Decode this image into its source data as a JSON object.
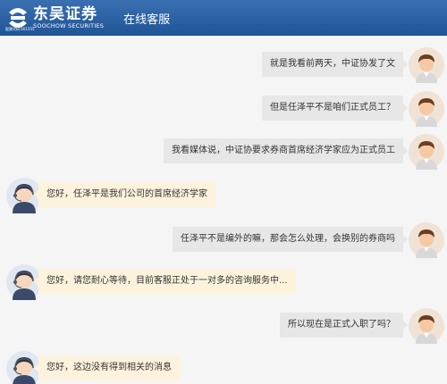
{
  "header": {
    "brand_cn": "东吴证券",
    "brand_en": "SOOCHOW SECURITIES",
    "brand_tag": "股票代码 601555",
    "title": "在线客服",
    "brand_color": "#1f5597"
  },
  "chat": {
    "messages": [
      {
        "sender": "user",
        "text": "就是我看前两天，中证协发了文"
      },
      {
        "sender": "user",
        "text": "但是任泽平不是咱们正式员工？"
      },
      {
        "sender": "user",
        "text": "我看媒体说，中证协要求券商首席经济学家应为正式员工"
      },
      {
        "sender": "agent",
        "text": "您好，任泽平是我们公司的首席经济学家"
      },
      {
        "sender": "user",
        "text": "任泽平不是编外的嘛，那会怎么处理，会换别的券商吗"
      },
      {
        "sender": "agent",
        "text": "您好，请您耐心等待，目前客服正处于一对多的咨询服务中..."
      },
      {
        "sender": "user",
        "text": "所以现在是正式入职了吗？"
      },
      {
        "sender": "agent",
        "text": "您好，这边没有得到相关的消息"
      }
    ]
  }
}
